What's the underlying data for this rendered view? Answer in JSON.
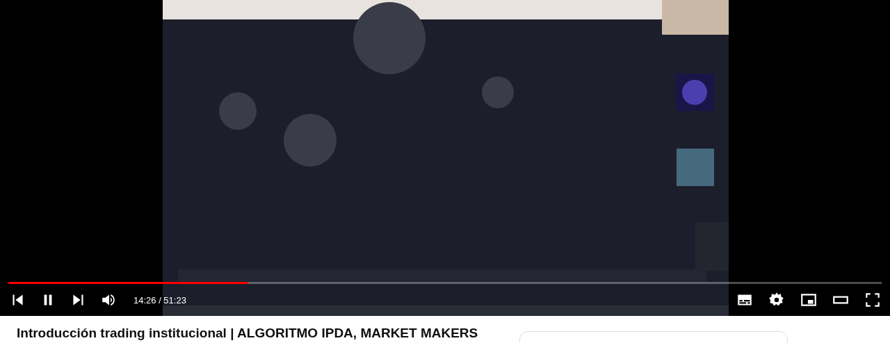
{
  "player": {
    "playing": true,
    "progress": {
      "level": 0.275
    },
    "time": "14:26 / 51:23"
  },
  "video": {
    "title": "Introducción trading institucional | ALGORITMO IPDA, MARKET MAKERS"
  }
}
